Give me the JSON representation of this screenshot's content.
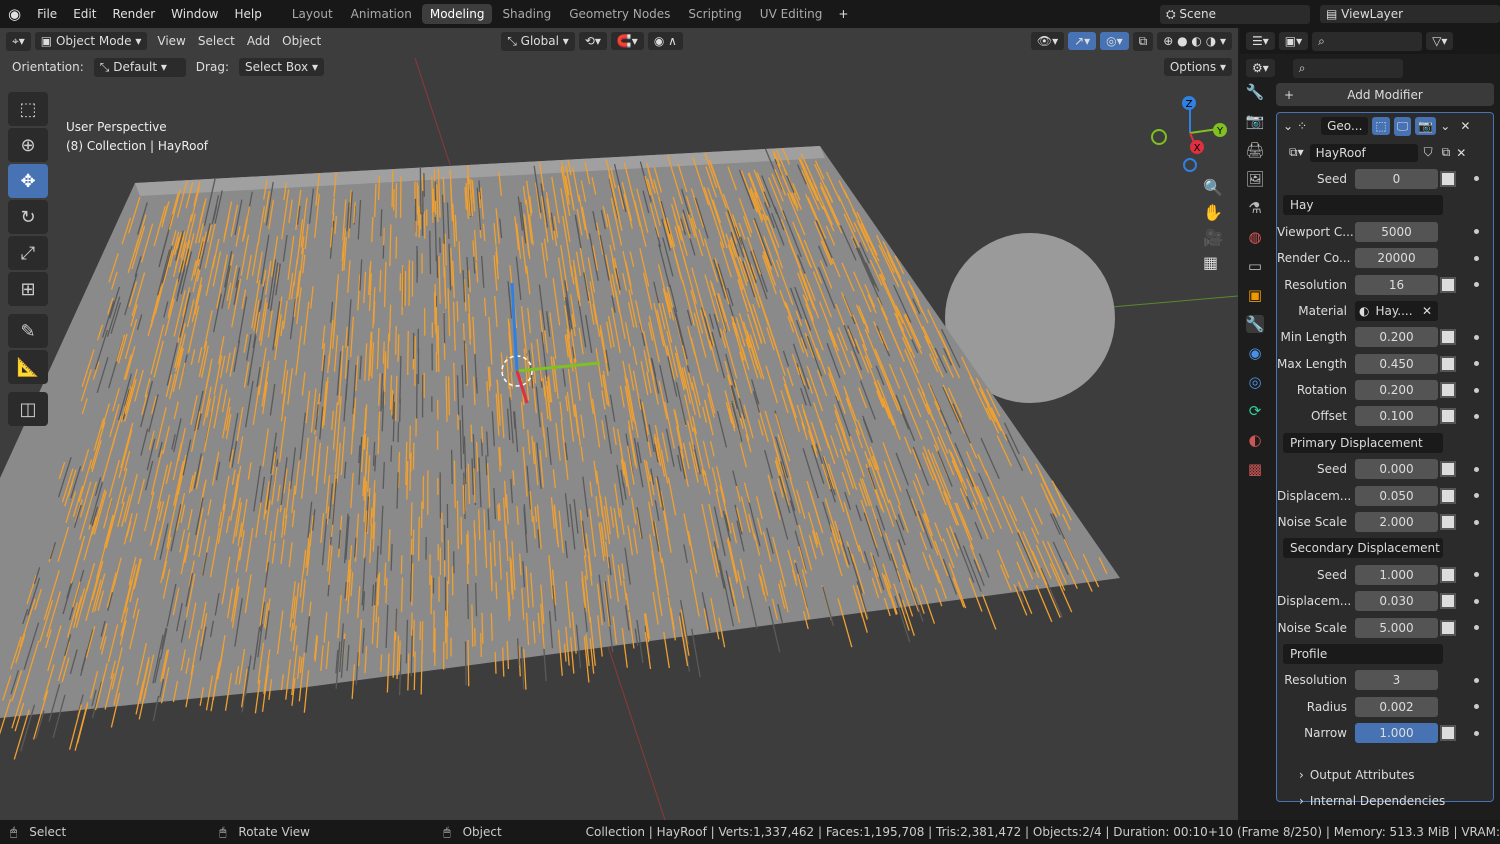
{
  "menu": [
    "File",
    "Edit",
    "Render",
    "Window",
    "Help"
  ],
  "workspaces": [
    "Layout",
    "Animation",
    "Modeling",
    "Shading",
    "Geometry Nodes",
    "Scripting",
    "UV Editing"
  ],
  "active_workspace": "Modeling",
  "scene": "Scene",
  "view_layer": "ViewLayer",
  "viewport_header": {
    "mode": "Object Mode",
    "menus": [
      "View",
      "Select",
      "Add",
      "Object"
    ],
    "transform": "Global"
  },
  "tool_settings": {
    "orientation_label": "Orientation:",
    "orientation": "Default",
    "drag_label": "Drag:",
    "drag": "Select Box",
    "options": "Options"
  },
  "viewport_info": {
    "line1": "User Perspective",
    "line2": "(8) Collection | HayRoof"
  },
  "gizmo": {
    "x": "X",
    "y": "Y",
    "z": "Z"
  },
  "colors": {
    "accent": "#4772b3",
    "hay": "#f0a030",
    "x_axis": "#e03040",
    "y_axis": "#80c020",
    "z_axis": "#3080e0"
  },
  "properties": {
    "add_modifier": "Add Modifier",
    "modifier_name": "Geo...",
    "node_group": "HayRoof",
    "rows": [
      {
        "type": "field",
        "label": "Seed",
        "value": "0",
        "kf": true
      },
      {
        "type": "section",
        "label": "Hay"
      },
      {
        "type": "field",
        "label": "Viewport C...",
        "value": "5000"
      },
      {
        "type": "field",
        "label": "Render Co...",
        "value": "20000"
      },
      {
        "type": "field",
        "label": "Resolution",
        "value": "16",
        "kf": true
      },
      {
        "type": "field",
        "label": "Material",
        "value": "Hay....",
        "material": true
      },
      {
        "type": "field",
        "label": "Min Length",
        "value": "0.200",
        "kf": true
      },
      {
        "type": "field",
        "label": "Max Length",
        "value": "0.450",
        "kf": true
      },
      {
        "type": "field",
        "label": "Rotation",
        "value": "0.200",
        "kf": true
      },
      {
        "type": "field",
        "label": "Offset",
        "value": "0.100",
        "kf": true
      },
      {
        "type": "section",
        "label": "Primary Displacement"
      },
      {
        "type": "field",
        "label": "Seed",
        "value": "0.000",
        "kf": true
      },
      {
        "type": "field",
        "label": "Displacem...",
        "value": "0.050",
        "kf": true
      },
      {
        "type": "field",
        "label": "Noise Scale",
        "value": "2.000",
        "kf": true
      },
      {
        "type": "section",
        "label": "Secondary Displacement"
      },
      {
        "type": "field",
        "label": "Seed",
        "value": "1.000",
        "kf": true
      },
      {
        "type": "field",
        "label": "Displacem...",
        "value": "0.030",
        "kf": true
      },
      {
        "type": "field",
        "label": "Noise Scale",
        "value": "5.000",
        "kf": true
      },
      {
        "type": "section",
        "label": "Profile"
      },
      {
        "type": "field",
        "label": "Resolution",
        "value": "3"
      },
      {
        "type": "field",
        "label": "Radius",
        "value": "0.002"
      },
      {
        "type": "field",
        "label": "Narrow",
        "value": "1.000",
        "kf": true,
        "hl": true
      }
    ],
    "subpanels": [
      "Output Attributes",
      "Internal Dependencies"
    ]
  },
  "status": {
    "select": "Select",
    "rotate": "Rotate View",
    "object": "Object",
    "stats": "Collection | HayRoof | Verts:1,337,462 | Faces:1,195,708 | Tris:2,381,472 | Objects:2/4 | Duration: 00:10+10 (Frame 8/250) | Memory: 513.3 MiB | VRAM:"
  }
}
